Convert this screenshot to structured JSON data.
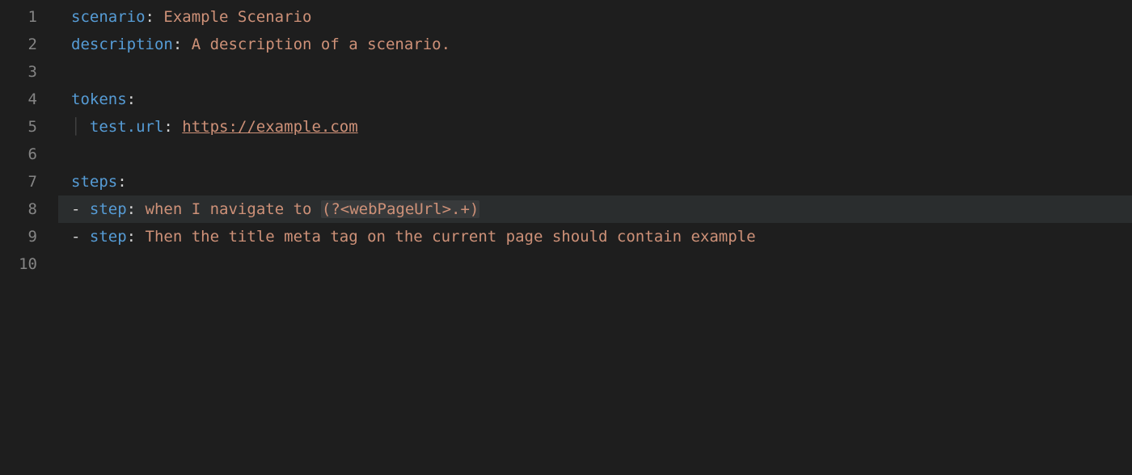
{
  "gutter": {
    "line1": "1",
    "line2": "2",
    "line3": "3",
    "line4": "4",
    "line5": "5",
    "line6": "6",
    "line7": "7",
    "line8": "8",
    "line9": "9",
    "line10": "10"
  },
  "code": {
    "l1": {
      "key": "scenario",
      "colon": ": ",
      "value": "Example Scenario"
    },
    "l2": {
      "key": "description",
      "colon": ": ",
      "value": "A description of a scenario."
    },
    "l4": {
      "key": "tokens",
      "colon": ":"
    },
    "l5": {
      "guide": "│ ",
      "key": "test.url",
      "colon": ": ",
      "value": "https://example.com"
    },
    "l7": {
      "key": "steps",
      "colon": ":"
    },
    "l8": {
      "dash": "- ",
      "key": "step",
      "colon": ": ",
      "val_a": "when I navigate to ",
      "val_b": "(?<webPageUrl>.+)"
    },
    "l9": {
      "dash": "- ",
      "key": "step",
      "colon": ": ",
      "value": "Then the title meta tag on the current page should contain example"
    }
  }
}
